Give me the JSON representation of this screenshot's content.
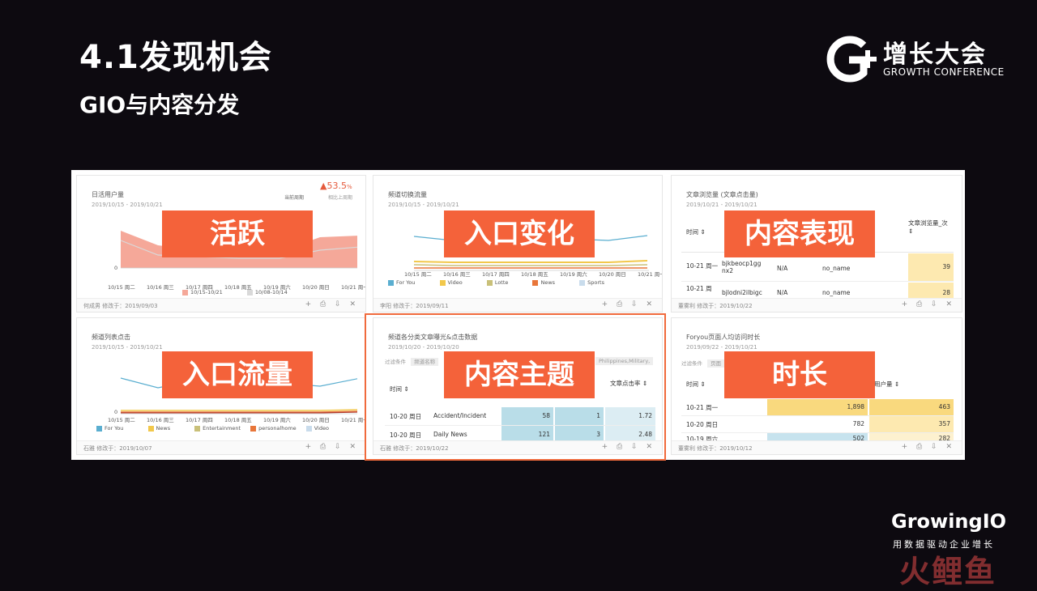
{
  "slide": {
    "title": "4.1发现机会",
    "subtitle": "GIO与内容分发"
  },
  "logo": {
    "cn": "增长大会",
    "en": "GROWTH CONFERENCE"
  },
  "footer_brand": {
    "name": "GrowingIO",
    "tagline": "用数据驱动企业增长",
    "watermark": "火鲤鱼"
  },
  "panels": [
    {
      "title": "日活用户量",
      "date": "2019/10/15 - 2019/10/21",
      "metric_value": "▲53.5",
      "metric_unit": "%",
      "metric_left": "当前周期",
      "metric_right": "相比上周期",
      "y_zero": "0",
      "xticks": [
        "10/15 周二",
        "10/16 周三",
        "10/17 周四",
        "10/18 周五",
        "10/19 周六",
        "10/20 周日",
        "10/21 周一"
      ],
      "legend": [
        "10/15-10/21",
        "10/08-10/14"
      ],
      "footer": "何成男 修改于：2019/09/03",
      "tag": "活跃"
    },
    {
      "title": "频道切换流量",
      "date": "2019/10/15 - 2019/10/21",
      "xticks": [
        "10/15 周二",
        "10/16 周三",
        "10/17 周四",
        "10/18 周五",
        "10/19 周六",
        "10/20 周日",
        "10/21 周一"
      ],
      "legend": [
        "For You",
        "Video",
        "Lotte",
        "News",
        "Sports"
      ],
      "footer": "李阳 修改于：2019/09/11",
      "tag": "入口变化"
    },
    {
      "title": "文章浏览量 (文章点击量)",
      "date": "2019/10/21 - 2019/10/21",
      "col_time": "时间",
      "col_views": "文章浏览量_次",
      "rows": [
        {
          "time": "10-21 周一",
          "id": "bjkbeocp1ggnx2",
          "na": "N/A",
          "name": "no_name",
          "views": "39"
        },
        {
          "time": "10-21 周",
          "id": "bjlodni2ilbigc",
          "na": "N/A",
          "name": "no_name",
          "views": "28"
        }
      ],
      "footer": "董雾利 修改于：2019/10/22",
      "tag": "内容表现"
    },
    {
      "title": "频道列表点击",
      "date": "2019/10/15 - 2019/10/21",
      "y_zero": "0",
      "xticks": [
        "10/15 周二",
        "10/16 周三",
        "10/17 周四",
        "10/18 周五",
        "10/19 周六",
        "10/20 周日",
        "10/21 周一"
      ],
      "legend": [
        "For You",
        "News",
        "Entertainment",
        "personalhome",
        "Video"
      ],
      "footer": "石雅 修改于：2019/10/07",
      "tag": "入口流量"
    },
    {
      "title": "频道各分类文章曝光&点击数据",
      "date": "2019/10/20 - 2019/10/20",
      "filter_label": "过滤条件",
      "filter_chip": "频道名称",
      "filter_values": "Philippines,Military,",
      "col_time": "时间",
      "col_ctr": "文章点击率",
      "rows": [
        {
          "time": "10-20 周日",
          "cat": "Accident/Incident",
          "a": "58",
          "b": "1",
          "ctr": "1.72"
        },
        {
          "time": "10-20 周日",
          "cat": "Daily News",
          "a": "121",
          "b": "3",
          "ctr": "2.48"
        }
      ],
      "footer": "石雅 修改于：2019/10/22",
      "tag": "内容主题"
    },
    {
      "title": "Foryou页面人均访问时长",
      "date": "2019/09/22 - 2019/10/21",
      "filter_label": "过滤条件",
      "filter_chip": "页面",
      "col_time": "时间",
      "col_users": "用户量",
      "rows": [
        {
          "time": "10-21 周一",
          "a": "1,898",
          "users": "463"
        },
        {
          "time": "10-20 周日",
          "a": "782",
          "users": "357"
        },
        {
          "time": "10-19 周六",
          "a": "502",
          "users": "282"
        }
      ],
      "footer": "董雾利 修改于：2019/10/12",
      "tag": "时长"
    }
  ],
  "icons": {
    "footer_tools": "+ ⎙ ⇩ ✕"
  },
  "colors": {
    "background": "#0d0a10",
    "tag": "#f4623a",
    "highlight_border": "#f06a3c",
    "table_teal": "#b9dde8",
    "table_yellow": "#fde9b0",
    "area": "#f5a899"
  }
}
